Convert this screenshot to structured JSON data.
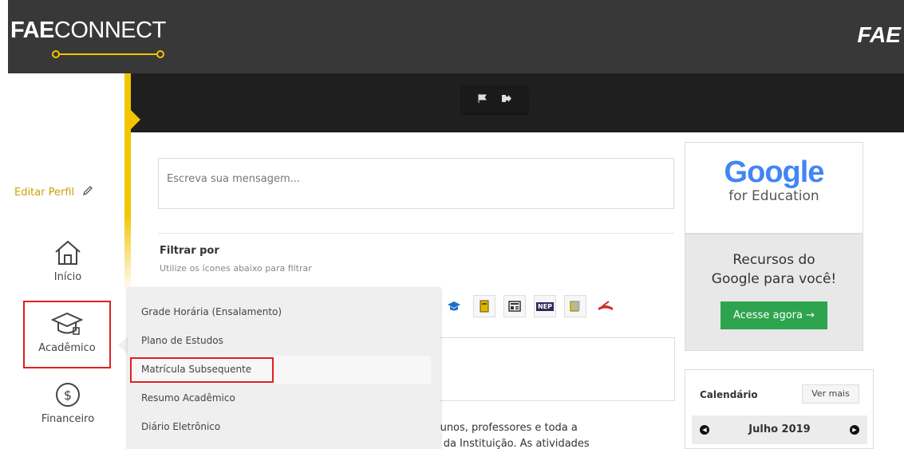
{
  "header": {
    "brand_bold": "FAE",
    "brand_light": "CONNECT",
    "right_logo": "FAE",
    "toolbar_icons": [
      "flag-icon",
      "logout-icon"
    ]
  },
  "sidebar": {
    "edit_profile": "Editar Perfil",
    "items": [
      {
        "label": "Início",
        "icon": "home-icon"
      },
      {
        "label": "Acadêmico",
        "icon": "graduation-cap-icon"
      },
      {
        "label": "Financeiro",
        "icon": "dollar-icon"
      }
    ]
  },
  "compose": {
    "placeholder": "Escreva sua mensagem..."
  },
  "filter": {
    "title": "Filtrar por",
    "subtitle": "Utilize os ícones abaixo para filtrar",
    "icons": [
      "graduation-cap-icon",
      "book-icon",
      "news-icon",
      "nep-icon",
      "notes-icon",
      "reading-icon"
    ],
    "nep_label": "NEP"
  },
  "academic_menu": {
    "items": [
      "Grade Horária (Ensalamento)",
      "Plano de Estudos",
      "Matrícula Subsequente",
      "Resumo Acadêmico",
      "Diário Eletrônico"
    ]
  },
  "post": {
    "line1": "alunos, professores e toda a",
    "line2": "al da Instituição. As atividades"
  },
  "google_ad": {
    "logo": "Google",
    "subtitle": "for Education",
    "title_line1": "Recursos do",
    "title_line2": "Google para você!",
    "button": "Acesse agora →"
  },
  "calendar": {
    "title": "Calendário",
    "more": "Ver mais",
    "month": "Julho 2019"
  },
  "colors": {
    "accent": "#f2c500",
    "highlight": "#e02020",
    "button_green": "#2ea44f",
    "header_bg": "#383838"
  }
}
